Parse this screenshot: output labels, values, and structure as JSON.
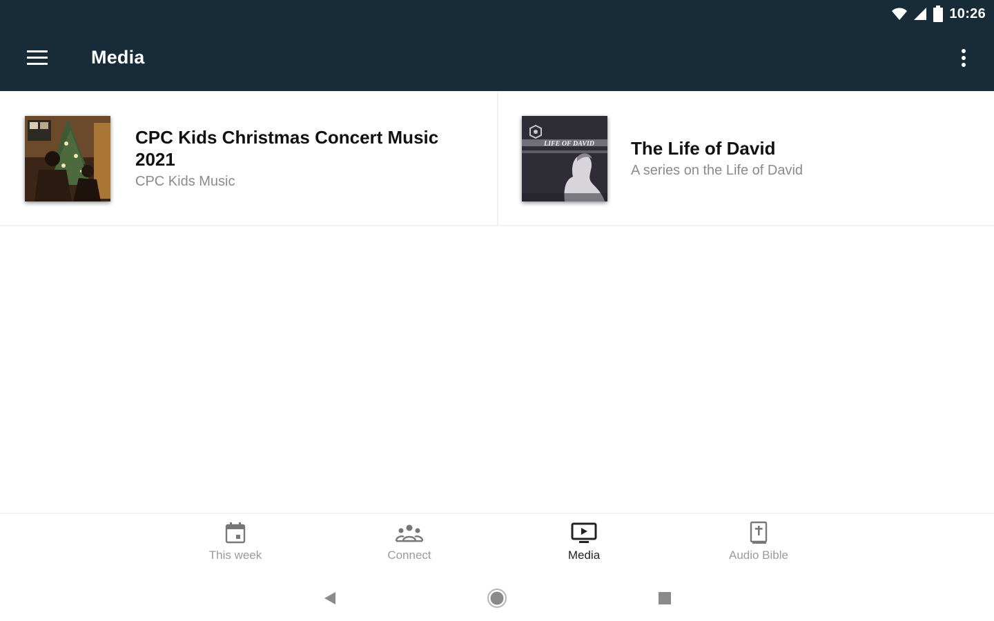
{
  "status_bar": {
    "time": "10:26",
    "icons": [
      "wifi-icon",
      "cell-signal-icon",
      "battery-icon"
    ]
  },
  "app_bar": {
    "title": "Media",
    "menu_icon": "hamburger-menu-icon",
    "overflow_icon": "more-vert-icon"
  },
  "media_items": [
    {
      "title": "CPC Kids Christmas Concert Music 2021",
      "subtitle": "CPC Kids Music",
      "thumbnail": "christmas-concert-photo"
    },
    {
      "title": "The Life of David",
      "subtitle": "A series on the Life of David",
      "thumbnail": "life-of-david-artwork",
      "thumbnail_text": "LIFE OF DAVID"
    }
  ],
  "bottom_nav": {
    "items": [
      {
        "label": "This week",
        "icon": "calendar-icon",
        "active": false
      },
      {
        "label": "Connect",
        "icon": "people-icon",
        "active": false
      },
      {
        "label": "Media",
        "icon": "play-screen-icon",
        "active": true
      },
      {
        "label": "Audio Bible",
        "icon": "bible-icon",
        "active": false
      }
    ]
  },
  "system_nav": {
    "buttons": [
      "back-icon",
      "home-icon",
      "recents-icon"
    ]
  },
  "colors": {
    "app_bar_bg": "#182b38",
    "active_nav": "#222222",
    "inactive_nav": "#9b9b9b",
    "subtitle": "#8a8a8a"
  }
}
